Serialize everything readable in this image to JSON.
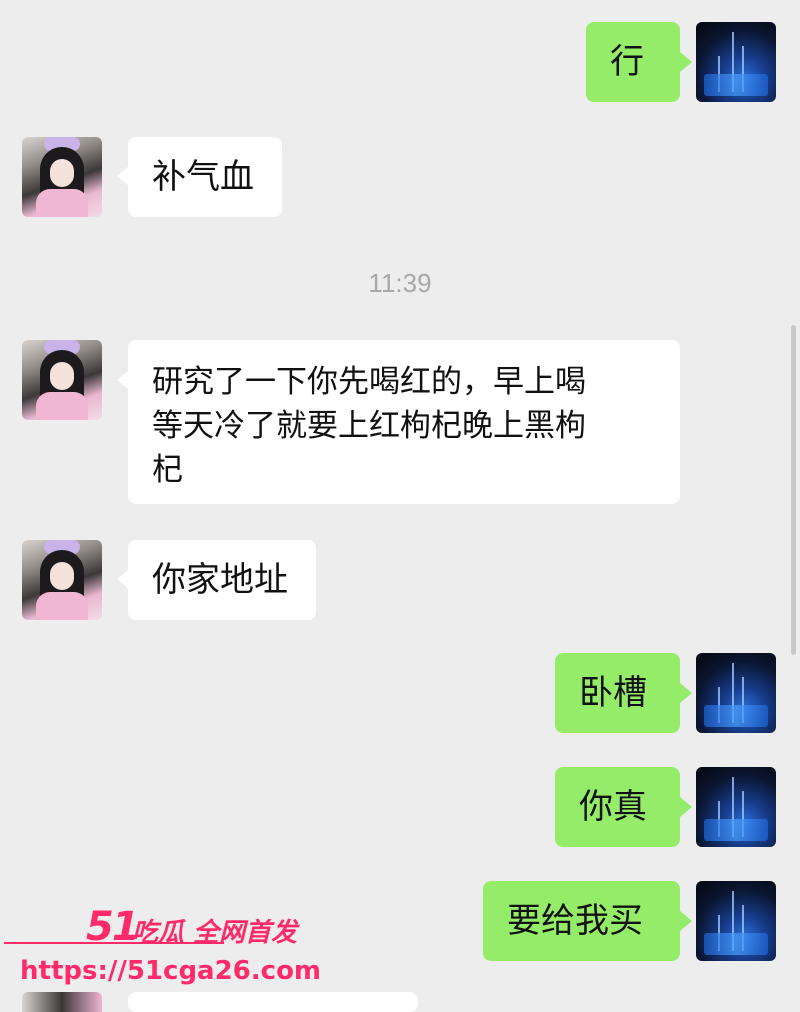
{
  "chat": {
    "timestamp": "11:39",
    "messages": [
      {
        "side": "right",
        "text": "行"
      },
      {
        "side": "left",
        "text": "补气血"
      },
      {
        "side": "left",
        "text": "研究了一下你先喝红的，早上喝\n等天冷了就要上红枸杞晚上黑枸\n杞"
      },
      {
        "side": "left",
        "text": "你家地址"
      },
      {
        "side": "right",
        "text": "卧槽"
      },
      {
        "side": "right",
        "text": "你真"
      },
      {
        "side": "right",
        "text": "要给我买"
      }
    ]
  },
  "watermark": {
    "logo": "51",
    "title": "吃瓜 全网首发",
    "url": "https://51cga26.com"
  },
  "colors": {
    "background": "#ededed",
    "sent_bubble": "#95ec69",
    "received_bubble": "#ffffff",
    "watermark": "#ff2a6a"
  }
}
